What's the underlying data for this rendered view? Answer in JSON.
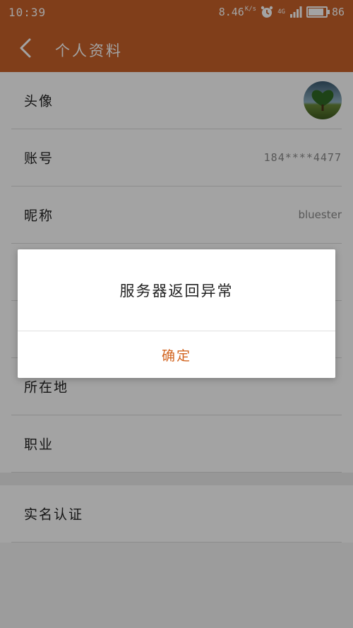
{
  "status_bar": {
    "time": "10:39",
    "speed": "8.46",
    "speed_unit": "K/s",
    "network": "4G",
    "battery": "86",
    "battery_fraction": 0.86
  },
  "toolbar": {
    "title": "个人资料",
    "back_icon": "chevron-left-icon"
  },
  "profile": {
    "rows": [
      {
        "label": "头像",
        "value": ""
      },
      {
        "label": "账号",
        "value": "184****4477"
      },
      {
        "label": "昵称",
        "value": "bluester"
      },
      {
        "label": "",
        "value": ""
      },
      {
        "label": "",
        "value": ""
      },
      {
        "label": "所在地",
        "value": ""
      },
      {
        "label": "职业",
        "value": ""
      }
    ],
    "rows2": [
      {
        "label": "实名认证",
        "value": ""
      }
    ]
  },
  "dialog": {
    "message": "服务器返回异常",
    "confirm_label": "确定"
  },
  "colors": {
    "accent": "#c8622a",
    "dialog_button": "#d2641f"
  }
}
